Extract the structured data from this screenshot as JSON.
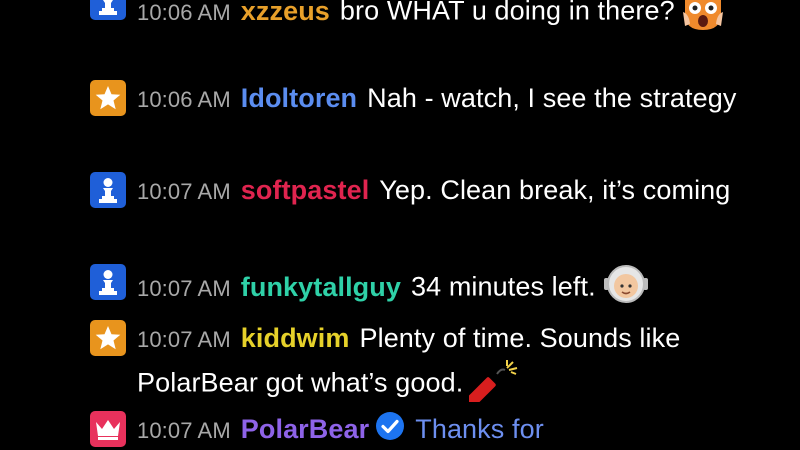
{
  "chat": {
    "messages": [
      {
        "badge": "pawn-icon",
        "badge_color": "#1f5fd8",
        "time": "10:06 AM",
        "user": "xzzeus",
        "user_color": "#e8a02a",
        "text": "bro WHAT u doing in there?",
        "emote": "shocked-cat-emote"
      },
      {
        "badge": "star-icon",
        "badge_color": "#e8941d",
        "time": "10:06 AM",
        "user": "Idoltoren",
        "user_color": "#5b8df0",
        "text": "Nah - watch, I see the strategy"
      },
      {
        "badge": "pawn-icon",
        "badge_color": "#1f5fd8",
        "time": "10:07 AM",
        "user": "softpastel",
        "user_color": "#e0244f",
        "text": "Yep. Clean break, it’s coming"
      },
      {
        "badge": "pawn-icon",
        "badge_color": "#1f5fd8",
        "time": "10:07 AM",
        "user": "funkytallguy",
        "user_color": "#2fd1a8",
        "text": "34 minutes left.",
        "emote": "astronaut-emote"
      },
      {
        "badge": "star-icon",
        "badge_color": "#e8941d",
        "time": "10:07 AM",
        "user": "kiddwim",
        "user_color": "#e6d12a",
        "text": "Plenty of time. Sounds like PolarBear got what’s good.",
        "emote": "firecracker-emote"
      },
      {
        "badge": "crown-icon",
        "badge_color": "#e8315c",
        "time": "10:07 AM",
        "user": "PolarBear",
        "user_color": "#8e63e8",
        "verified": "verified-check-icon",
        "text": "Thanks for",
        "text_color": "#6d8ff0"
      }
    ]
  }
}
